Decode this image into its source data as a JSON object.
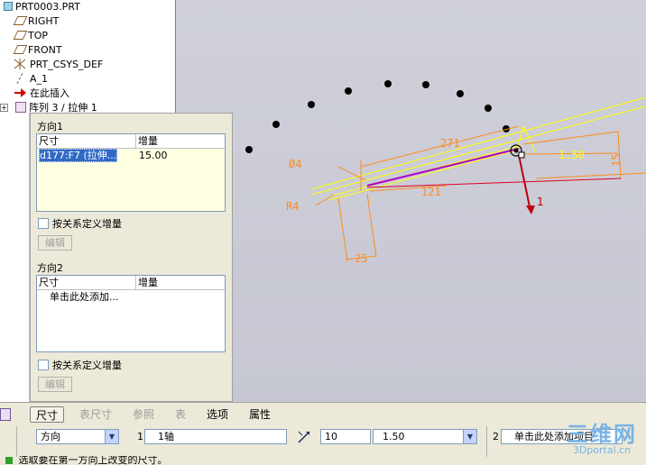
{
  "tree": {
    "items": [
      {
        "label": "PRT0003.PRT",
        "icon": "part-icon"
      },
      {
        "label": "RIGHT",
        "icon": "datum-plane-icon"
      },
      {
        "label": "TOP",
        "icon": "datum-plane-icon"
      },
      {
        "label": "FRONT",
        "icon": "datum-plane-icon"
      },
      {
        "label": "PRT_CSYS_DEF",
        "icon": "csys-icon"
      },
      {
        "label": "A_1",
        "icon": "datum-axis-icon"
      },
      {
        "label": "在此插入",
        "icon": "insert-here-icon"
      },
      {
        "label": "阵列 3 / 拉伸 1",
        "icon": "pattern-icon"
      }
    ]
  },
  "panel": {
    "dir1_title": "方向1",
    "dir1_col_dim": "尺寸",
    "dir1_col_inc": "增量",
    "dir1_row_dim": "d177:F7 (拉伸...",
    "dir1_row_inc": "15.00",
    "dir1_checkbox": "按关系定义增量",
    "dir1_edit": "编辑",
    "dir2_title": "方向2",
    "dir2_col_dim": "尺寸",
    "dir2_col_inc": "增量",
    "dir2_add": "单击此处添加...",
    "dir2_checkbox": "按关系定义增量",
    "dir2_edit": "编辑"
  },
  "model": {
    "dim_271": "271",
    "dim_phi4": "Ø4",
    "dim_r4": "R4",
    "dim_121": "121",
    "dim_25": "25",
    "dim_15": "15",
    "dim_150": "1.50",
    "axis_label": "1"
  },
  "dashboard": {
    "tabs": [
      "尺寸",
      "表尺寸",
      "参照",
      "表",
      "选项",
      "属性"
    ],
    "type_select": "方向",
    "num1": "1",
    "axis_field": "1轴",
    "count_field": "10",
    "spacing_select": "1.50",
    "num2": "2",
    "add_item_field": "单击此处添加项目"
  },
  "status": {
    "message": "选取要在第一方向上改变的尺寸。"
  },
  "watermark": {
    "big": "三维网",
    "small": "3Dportal.cn"
  },
  "colors": {
    "orange": "#ff8c1a",
    "yellow": "#ffff00",
    "red": "#e00020",
    "magenta": "#b000c0"
  }
}
